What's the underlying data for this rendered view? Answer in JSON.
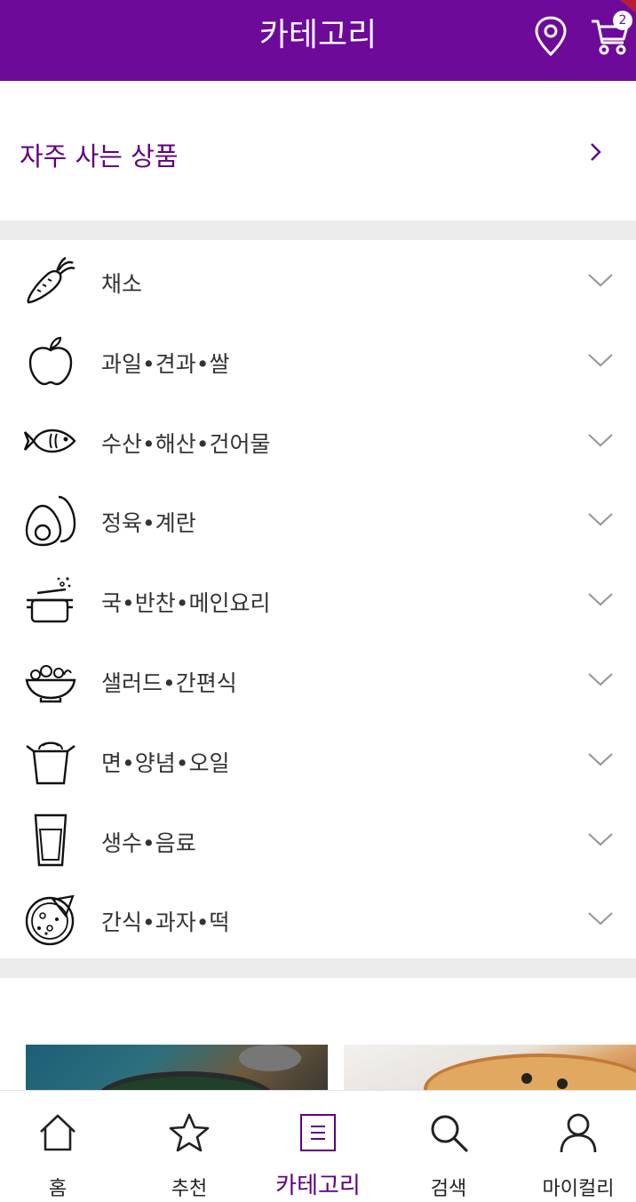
{
  "header": {
    "title": "카테고리",
    "location_icon": "location-pin-icon",
    "cart_icon": "cart-icon",
    "cart_count": "2",
    "brand_color": "#6d0a99"
  },
  "frequent": {
    "label": "자주 사는 상품",
    "icon": "chevron-right-icon"
  },
  "categories": [
    {
      "label": "채소",
      "icon": "carrot-icon"
    },
    {
      "label": "과일•견과•쌀",
      "icon": "apple-icon"
    },
    {
      "label": "수산•해산•건어물",
      "icon": "fish-icon"
    },
    {
      "label": "정육•계란",
      "icon": "egg-icon"
    },
    {
      "label": "국•반찬•메인요리",
      "icon": "pot-icon"
    },
    {
      "label": "샐러드•간편식",
      "icon": "salad-bowl-icon"
    },
    {
      "label": "면•양념•오일",
      "icon": "noodle-box-icon"
    },
    {
      "label": "생수•음료",
      "icon": "glass-icon"
    },
    {
      "label": "간식•과자•떡",
      "icon": "pizza-icon"
    }
  ],
  "tabs": [
    {
      "label": "홈",
      "icon": "home-icon",
      "active": false
    },
    {
      "label": "추천",
      "icon": "star-icon",
      "active": false
    },
    {
      "label": "카테고리",
      "icon": "list-icon",
      "active": true
    },
    {
      "label": "검색",
      "icon": "search-icon",
      "active": false
    },
    {
      "label": "마이컬리",
      "icon": "user-icon",
      "active": false
    }
  ],
  "colors": {
    "accent": "#5f0080",
    "divider": "#ececec"
  }
}
